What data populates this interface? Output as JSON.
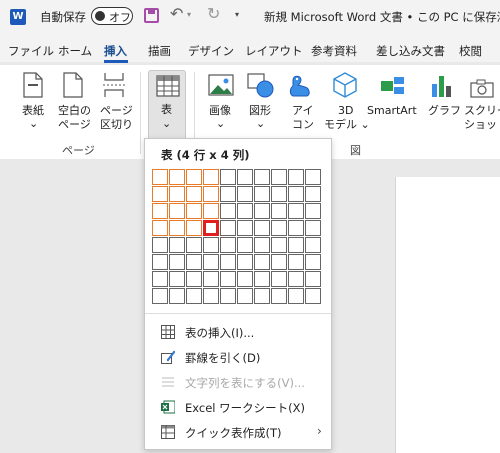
{
  "titlebar": {
    "autosave_label": "自動保存",
    "autosave_state": "オフ",
    "doc_title": "新規 Microsoft Word 文書 • この PC に保存済み"
  },
  "tabs": [
    {
      "label": "ファイル"
    },
    {
      "label": "ホーム"
    },
    {
      "label": "挿入"
    },
    {
      "label": "描画"
    },
    {
      "label": "デザイン"
    },
    {
      "label": "レイアウト"
    },
    {
      "label": "参考資料"
    },
    {
      "label": "差し込み文書"
    },
    {
      "label": "校閲"
    }
  ],
  "ribbon": {
    "cover": {
      "line1": "表紙",
      "line2": "⌄"
    },
    "blank_page": {
      "line1": "空白の",
      "line2": "ページ"
    },
    "page_break": {
      "line1": "ページ",
      "line2": "区切り"
    },
    "table": {
      "line1": "表",
      "line2": "⌄"
    },
    "pictures": {
      "line1": "画像",
      "line2": "⌄"
    },
    "shapes": {
      "line1": "図形",
      "line2": "⌄"
    },
    "icons": {
      "line1": "アイ",
      "line2": "コン"
    },
    "models": {
      "line1": "3D",
      "line2": "モデル ⌄"
    },
    "smartart": {
      "line1": "SmartArt"
    },
    "chart": {
      "line1": "グラフ"
    },
    "screenshot": {
      "line1": "スクリー",
      "line2": "ショット"
    },
    "group_pages": "ページ",
    "group_illustrations": "図"
  },
  "table_dropdown": {
    "title": "表 (4 行 x 4 列)",
    "rows": 8,
    "cols": 10,
    "selected_rows": 4,
    "selected_cols": 4,
    "menu": [
      {
        "label": "表の挿入(I)...",
        "disabled": false
      },
      {
        "label": "罫線を引く(D)",
        "disabled": false
      },
      {
        "label": "文字列を表にする(V)...",
        "disabled": true
      },
      {
        "label": "Excel ワークシート(X)",
        "disabled": false
      },
      {
        "label": "クイック表作成(T)",
        "disabled": false
      }
    ]
  },
  "colors": {
    "accent": "#1d5ab9",
    "selection": "#e87b2c",
    "hover": "#e02020"
  }
}
